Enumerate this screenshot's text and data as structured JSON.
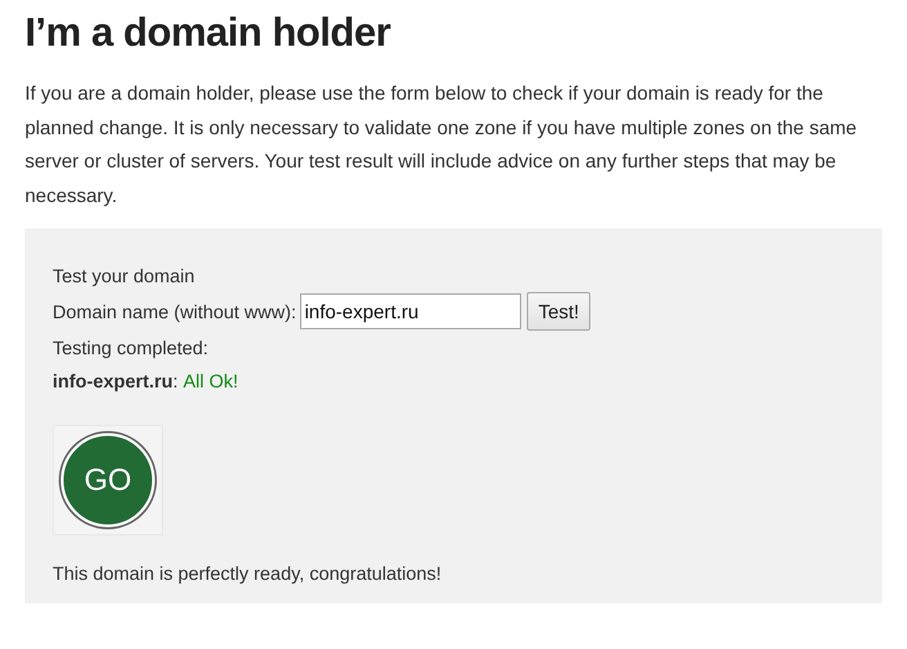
{
  "heading": "I’m a domain holder",
  "intro": "If you are a domain holder, please use the form below to check if your domain is ready for the planned change. It is only necessary to validate one zone if you have multiple zones on the same server or cluster of servers. Your test result will include advice on any further steps that may be necessary.",
  "test_panel": {
    "title": "Test your domain",
    "field_label": "Domain name (without www):",
    "field_value": "info-expert.ru",
    "button": "Test!",
    "status_line": "Testing completed:",
    "result_domain": "**info-expert.ru**:",
    "result_status": {
      "text": "All Ok!",
      "kind": "ok"
    },
    "badge": "GO",
    "message": "This domain is perfectly ready, congratulations!"
  }
}
